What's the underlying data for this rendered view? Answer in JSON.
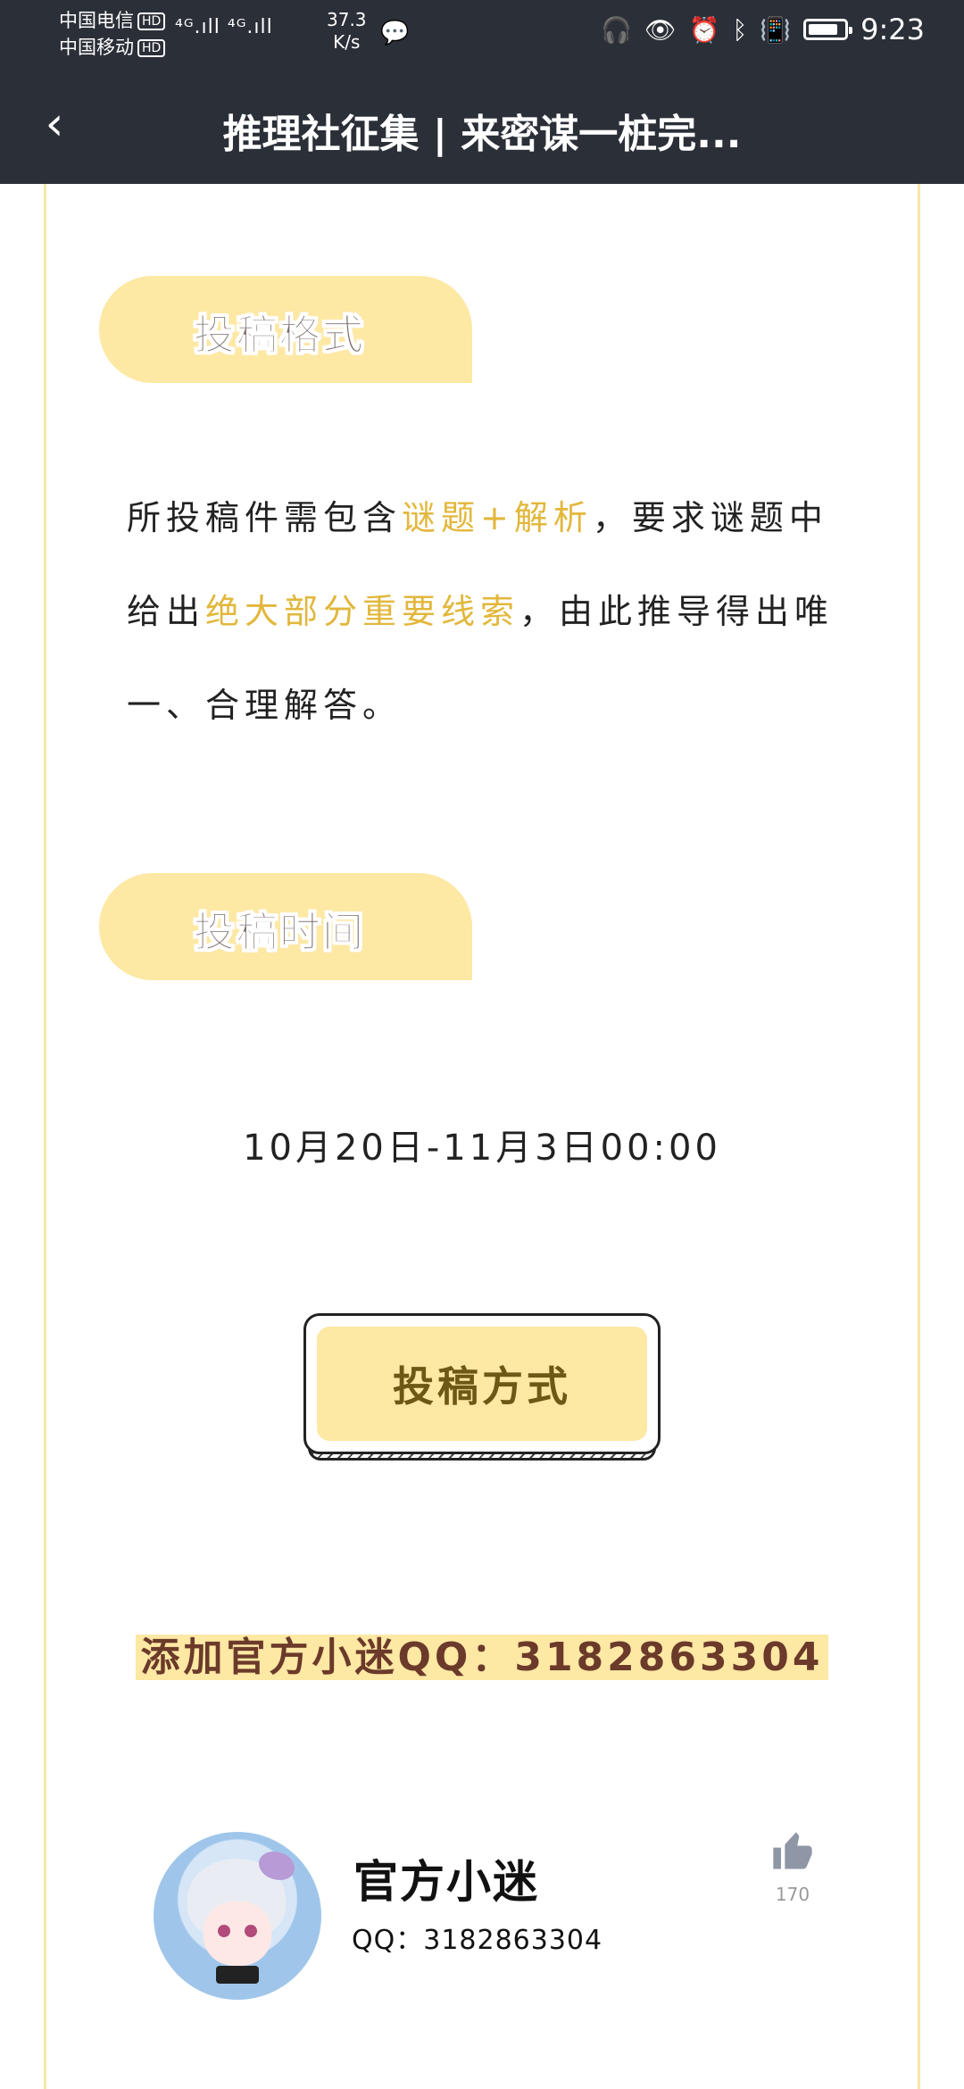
{
  "status_bar": {
    "carrier1": "中国电信",
    "carrier2": "中国移动",
    "hd_badge": "HD",
    "signal_text": "⁴ᴳ.ıll ⁴ᴳ.ıll",
    "net_speed": "37.3",
    "net_speed_unit": "K/s",
    "time": "9:23",
    "battery_level": 0.85
  },
  "header": {
    "title": "推理社征集 | 来密谋一桩完..."
  },
  "sections": {
    "format": {
      "heading": "投稿格式",
      "text_1": "所投稿件需包含",
      "highlight_1": "谜题+解析",
      "text_2": "，要求谜题中给出",
      "highlight_2": "绝大部分重要线索",
      "text_3": "，由此推导得出唯一、合理解答。"
    },
    "time": {
      "heading": "投稿时间",
      "text": "10月20日-11月3日00:00"
    }
  },
  "submit_button": {
    "label": "投稿方式"
  },
  "qq_line": {
    "text": "添加官方小迷QQ：3182863304"
  },
  "profile": {
    "name": "官方小迷",
    "qq": "QQ：3182863304",
    "likes": "170"
  },
  "colors": {
    "header_bg": "#2b2f38",
    "accent_yellow": "#fde8a4",
    "highlight_text": "#e2b73b"
  }
}
